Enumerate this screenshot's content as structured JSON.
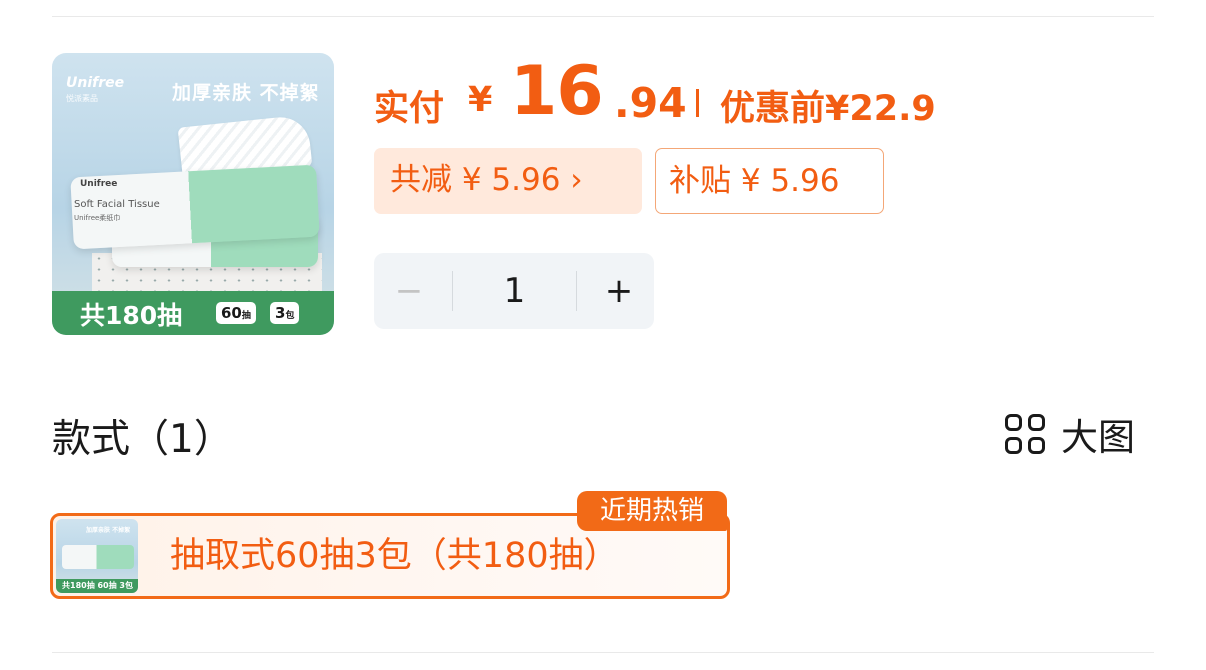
{
  "product": {
    "image": {
      "brand": "Unifree",
      "brand_sub": "悦派素品",
      "slogan": "加厚亲肤 不掉絮",
      "pack_brand": "Unifree",
      "pack_text": "Soft Facial Tissue",
      "pack_text2": "Unifree柔纸巾",
      "banner_main": "共180抽",
      "chip_count": "60",
      "chip_count_unit": "抽",
      "chip_packs": "3",
      "chip_packs_unit": "包"
    }
  },
  "price": {
    "pay_label": "实付",
    "currency": "¥",
    "pay_integer": "16",
    "pay_decimal": ".94",
    "original_label": "优惠前",
    "original_value": "¥22.9",
    "accent_color": "#f25d12"
  },
  "discounts": {
    "total_reduce": "共减 ¥ 5.96 ›",
    "subsidy": "补贴 ¥ 5.96"
  },
  "quantity": {
    "minus": "−",
    "value": "1",
    "plus": "+"
  },
  "styles_section": {
    "title": "款式（1）",
    "view_toggle_icon": "grid-icon",
    "view_toggle_label": "大图",
    "variants": [
      {
        "label": "抽取式60抽3包（共180抽）",
        "tag": "近期热销",
        "thumb_banner": "共180抽 60抽 3包",
        "thumb_slogan": "加厚亲肤 不掉絮",
        "selected": true
      }
    ]
  }
}
